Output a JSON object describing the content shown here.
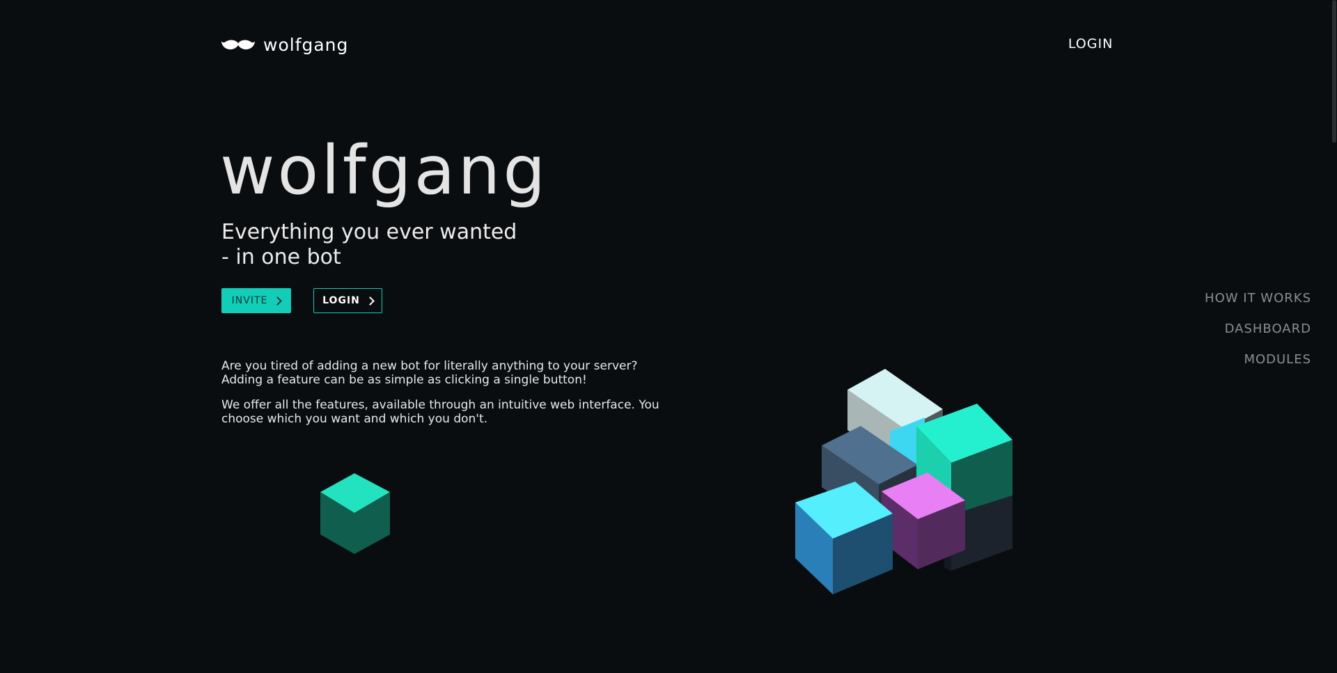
{
  "header": {
    "logo_text": "wolfgang",
    "logo_icon": "mustache-icon",
    "login_label": "LOGIN"
  },
  "hero": {
    "title": "wolfgang",
    "subtitle_line1": "Everything you ever wanted",
    "subtitle_line2": "- in one bot",
    "invite_label": "INVITE",
    "login_label": "LOGIN",
    "paragraph1_line1": "Are you tired of adding a new bot for literally anything to your server?",
    "paragraph1_line2": "Adding a feature can be as simple as clicking a single button!",
    "paragraph2": "We offer all the features, available through an intuitive web interface. You choose which you want and which you don't."
  },
  "side_nav": {
    "items": [
      {
        "label": "HOW IT WORKS"
      },
      {
        "label": "DASHBOARD"
      },
      {
        "label": "MODULES"
      }
    ]
  },
  "colors": {
    "background": "#0a0d10",
    "accent": "#12cdb8",
    "text": "#e8e8e8",
    "muted": "#8a8f94"
  }
}
